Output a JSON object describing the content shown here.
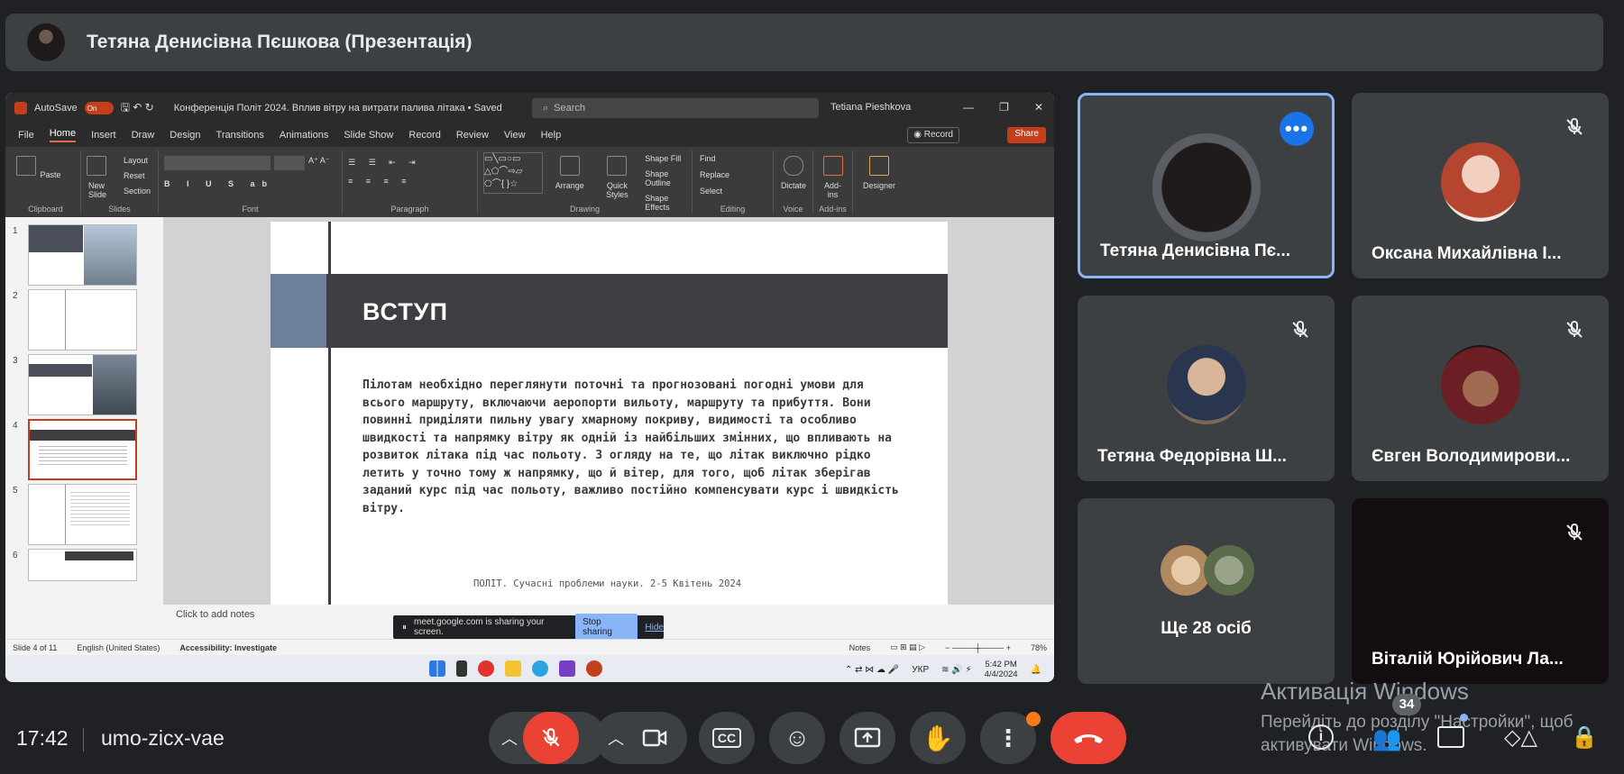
{
  "meet": {
    "presenter_title": "Тетяна Денисівна Пєшкова (Презентація)",
    "time": "17:42",
    "meeting_code": "umo-zicx-vae",
    "people_count": "34",
    "windows_activation_title": "Активація Windows",
    "windows_activation_text_1": "Перейдіть до розділу \"Настройки\", щоб",
    "windows_activation_text_2": "активувати Windows."
  },
  "participants": [
    {
      "name": "Тетяна Денисівна Пє...",
      "active_speaker": true,
      "muted": false
    },
    {
      "name": "Оксана Михайлівна І...",
      "muted": true
    },
    {
      "name": "Тетяна Федорівна Ш...",
      "muted": true
    },
    {
      "name": "Євген Володимирови...",
      "muted": true
    },
    {
      "name": "Ще 28 осіб",
      "muted": false
    },
    {
      "name": "Віталій Юрійович Ла...",
      "muted": true
    }
  ],
  "powerpoint": {
    "autosave_label": "AutoSave",
    "autosave_state": "On",
    "doc_title": "Конференція Політ 2024. Вплив вітру на витрати палива літака • Saved",
    "search_placeholder": "Search",
    "user_name": "Tetiana Pieshkova",
    "menu": [
      "File",
      "Home",
      "Insert",
      "Draw",
      "Design",
      "Transitions",
      "Animations",
      "Slide Show",
      "Record",
      "Review",
      "View",
      "Help"
    ],
    "record_label": "Record",
    "share_label": "Share",
    "ribbon_groups": {
      "clipboard": "Clipboard",
      "paste": "Paste",
      "slides": "Slides",
      "new_slide": "New Slide",
      "layout": "Layout",
      "reset": "Reset",
      "section": "Section",
      "font": "Font",
      "paragraph": "Paragraph",
      "drawing": "Drawing",
      "arrange": "Arrange",
      "quick_styles": "Quick Styles",
      "shape_fill": "Shape Fill",
      "shape_outline": "Shape Outline",
      "shape_effects": "Shape Effects",
      "editing": "Editing",
      "find": "Find",
      "replace": "Replace",
      "select": "Select",
      "voice": "Voice",
      "dictate": "Dictate",
      "addins": "Add-ins",
      "addins_btn": "Add-ins",
      "designer": "Designer"
    },
    "slide_numbers": [
      "1",
      "2",
      "3",
      "4",
      "5",
      "6"
    ],
    "slide": {
      "heading": "ВСТУП",
      "body": "Пілотам необхідно переглянути поточні та прогнозовані погодні умови для всього маршруту, включаючи аеропорти вильоту, маршруту та прибуття. Вони повинні приділяти пильну увагу хмарному покриву, видимості та особливо швидкості та напрямку вітру як одній із найбільших змінних, що впливають на розвиток літака під час польоту. З огляду на те, що літак виключно рідко летить у точно тому ж напрямку, що й вітер, для того, щоб літак зберігав заданий курс під час польоту, важливо постійно компенсувати курс і швидкість вітру.",
      "footer": "ПОЛІТ. Сучасні проблеми науки. 2-5 Квітень 2024"
    },
    "notes_placeholder": "Click to add notes",
    "sharing_text": "meet.google.com is sharing your screen.",
    "stop_sharing": "Stop sharing",
    "hide": "Hide",
    "status": {
      "slide_of": "Slide 4 of 11",
      "language": "English (United States)",
      "accessibility": "Accessibility: Investigate",
      "notes": "Notes",
      "zoom": "78%"
    },
    "taskbar": {
      "lang": "УКР",
      "time": "5:42 PM",
      "date": "4/4/2024"
    }
  },
  "colors": {
    "meet_bg": "#202124",
    "tile_bg": "#3c4043",
    "end_call": "#ea4335",
    "active_border": "#8ab4f8",
    "ppt_accent": "#c43e1c"
  }
}
